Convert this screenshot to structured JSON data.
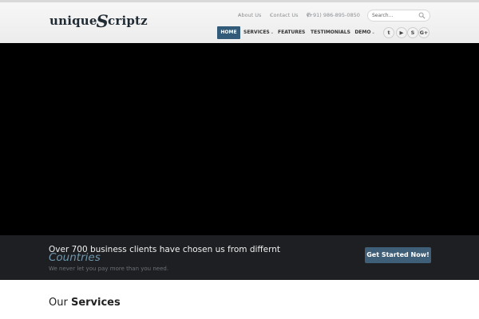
{
  "brand": {
    "logo_left": "unique",
    "logo_mark": "S",
    "logo_right": "criptz"
  },
  "top_links": {
    "about": "About Us",
    "contact": "Contact Us",
    "phone": "(+91) 986-895-0850"
  },
  "search": {
    "placeholder": "Search..."
  },
  "nav": {
    "items": [
      {
        "label": "HOME",
        "active": true
      },
      {
        "label": "SERVICES",
        "dropdown": true
      },
      {
        "label": "FEATURES"
      },
      {
        "label": "TESTIMONIALS"
      },
      {
        "label": "DEMO",
        "dropdown": true
      }
    ]
  },
  "social": [
    {
      "icon": "twitter-icon",
      "glyph": "t"
    },
    {
      "icon": "youtube-icon",
      "glyph": "▶"
    },
    {
      "icon": "skype-icon",
      "glyph": "S"
    },
    {
      "icon": "google-plus-icon",
      "glyph": "G+"
    }
  ],
  "banner": {
    "headline": "Over 700 business clients have chosen us from differnt",
    "highlight": "Countries",
    "subtext": "We never let you pay more than you need.",
    "cta_label": "Get Started Now!"
  },
  "services": {
    "title_light": "Our ",
    "title_bold": "Services"
  },
  "colors": {
    "nav_active": "#325a79",
    "cta": "#3f5e77",
    "highlight": "#6e96ad",
    "banner_bg": "#1d1f22",
    "hero_bg": "#000000"
  }
}
